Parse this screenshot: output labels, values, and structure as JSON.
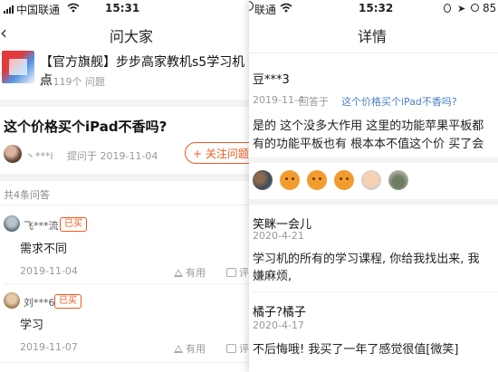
{
  "left_panel": {
    "status": {
      "carrier": "中国联通",
      "time": "15:31"
    },
    "nav": {
      "title": "问大家"
    },
    "product": {
      "title": "【官方旗舰】步步高家教机s5学习机点",
      "question_count": "共 119个 问题"
    },
    "question": {
      "title": "这个价格买个iPad不香吗?",
      "asker": "丶***i",
      "asked_at": "提问于 2019-11-04",
      "follow_label": "+ 关注问题"
    },
    "answers_header": "共4条问答",
    "answers": [
      {
        "name": "飞***流",
        "badge": "已买",
        "text": "需求不同",
        "date": "2019-11-04",
        "useful": "有用",
        "comment": "评"
      },
      {
        "name": "刘***6",
        "badge": "已买",
        "text": "学习",
        "date": "2019-11-07",
        "useful": "有用",
        "comment": "评"
      }
    ]
  },
  "right_panel": {
    "status": {
      "carrier": "联通",
      "time": "15:32",
      "battery": "85"
    },
    "nav": {
      "title": "详情"
    },
    "reply": {
      "author": "豆***3",
      "date": "2019-11-4",
      "reply_prefix": "回答于",
      "reply_to": "这个价格买个iPad不香吗?",
      "body_lines": [
        "是的 这个没多大作用 这里的功能苹果平板都",
        "有的功能平板也有 根本本不值这个价 买了会"
      ]
    },
    "reactions": [
      "photo",
      "emoji-angry",
      "emoji-angry",
      "emoji-angry",
      "face",
      "photo"
    ],
    "comments": [
      {
        "name": "笑眯一会儿",
        "date": "2020-4-21",
        "lines": [
          "学习机的所有的学习课程, 你给我找出来, 我",
          "嫌麻烦,"
        ]
      },
      {
        "name": "橘子?橘子",
        "date": "2020-4-17",
        "lines": [
          "不后悔哦! 我买了一年了感觉很值[微笑]"
        ]
      }
    ]
  }
}
